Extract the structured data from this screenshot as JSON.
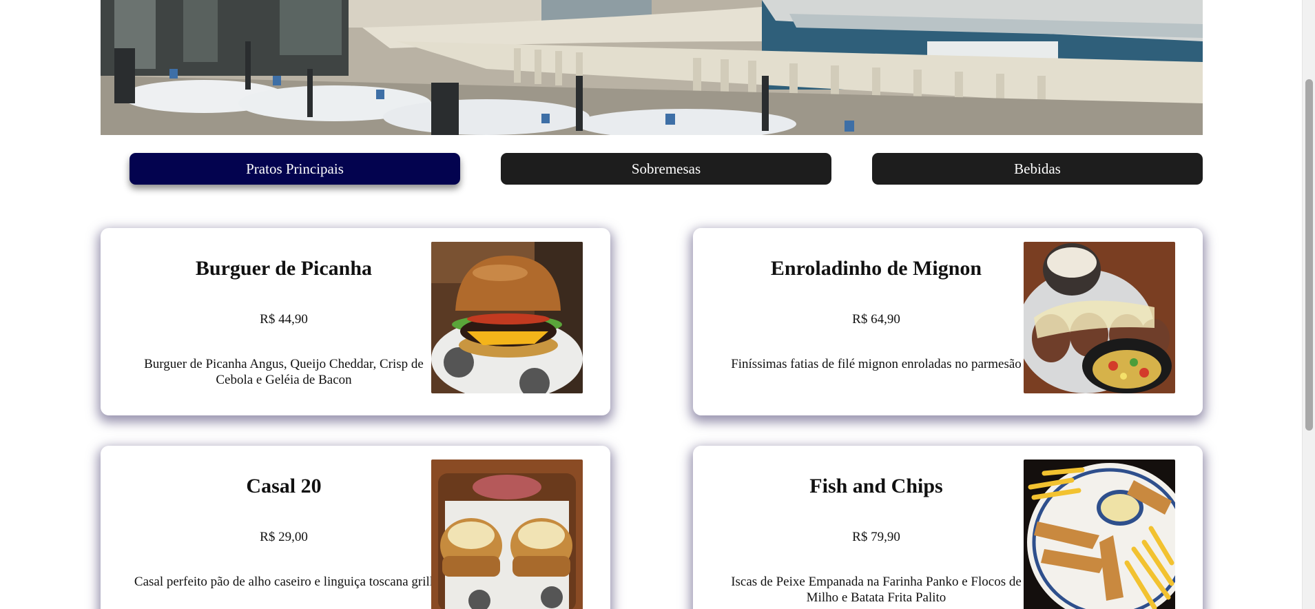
{
  "tabs": [
    {
      "label": "Pratos Principais",
      "active": true
    },
    {
      "label": "Sobremesas",
      "active": false
    },
    {
      "label": "Bebidas",
      "active": false
    }
  ],
  "dishes": [
    {
      "name": "Burguer de Picanha",
      "price": "R$ 44,90",
      "description": "Burguer de Picanha Angus, Queijo Cheddar, Crisp de Cebola e Geléia de Bacon",
      "image": "burger-photo"
    },
    {
      "name": "Enroladinho de Mignon",
      "price": "R$ 64,90",
      "description": "Finíssimas fatias de filé mignon enroladas no parmesão",
      "image": "mignon-rolls-photo"
    },
    {
      "name": "Casal 20",
      "price": "R$ 29,00",
      "description": "Casal perfeito pão de alho caseiro e linguiça toscana grill",
      "image": "garlic-bread-sausage-photo"
    },
    {
      "name": "Fish and Chips",
      "price": "R$ 79,90",
      "description": "Iscas de Peixe Empanada na Farinha Panko e Flocos de Milho e Batata Frita Palito",
      "image": "fish-and-chips-photo"
    }
  ],
  "colors": {
    "active_tab": "#03034f",
    "tab": "#1d1d1d",
    "card_shadow": "#463c6e"
  }
}
